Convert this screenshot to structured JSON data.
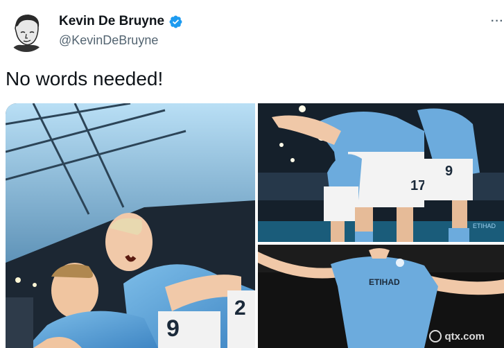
{
  "tweet": {
    "display_name": "Kevin De Bruyne",
    "handle": "@KevinDeBruyne",
    "verified_icon": "verified-badge-icon",
    "more_icon": "more-options-icon",
    "more_glyph": "···",
    "text": "No words needed!"
  },
  "media": {
    "photo_count": 3,
    "jersey_numbers": [
      "9",
      "17",
      "9",
      "2"
    ],
    "sponsor_text": "ETIHAD",
    "watermark": "qtx.com",
    "colors": {
      "sky_blue_kit": "#6cabdd",
      "stadium_dark": "#1c2733",
      "roof_light": "#9fd1f0"
    }
  },
  "colors": {
    "text_primary": "#0f1419",
    "text_secondary": "#536471",
    "verified_blue": "#1d9bf0"
  }
}
